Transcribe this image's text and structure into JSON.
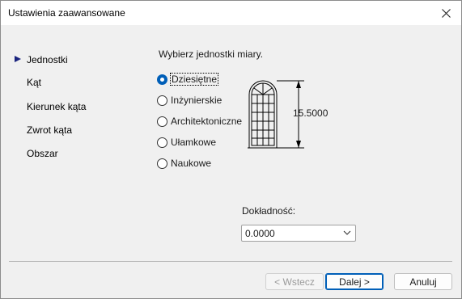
{
  "window": {
    "title": "Ustawienia zaawansowane"
  },
  "nav": {
    "items": [
      {
        "label": "Jednostki",
        "active": true
      },
      {
        "label": "Kąt",
        "active": false
      },
      {
        "label": "Kierunek kąta",
        "active": false
      },
      {
        "label": "Zwrot kąta",
        "active": false
      },
      {
        "label": "Obszar",
        "active": false
      }
    ]
  },
  "main": {
    "instruction": "Wybierz jednostki miary.",
    "options": [
      {
        "label": "Dziesiętne",
        "checked": true
      },
      {
        "label": "Inżynierskie",
        "checked": false
      },
      {
        "label": "Architektoniczne",
        "checked": false
      },
      {
        "label": "Ułamkowe",
        "checked": false
      },
      {
        "label": "Naukowe",
        "checked": false
      }
    ],
    "preview_dimension": "15.5000",
    "precision_label": "Dokładność:",
    "precision_value": "0.0000"
  },
  "footer": {
    "back_label": "< Wstecz",
    "next_label": "Dalej >",
    "cancel_label": "Anuluj"
  },
  "icons": {
    "close": "close-icon",
    "nav_marker": "triangle-right-icon",
    "dropdown": "chevron-down-icon",
    "preview": "window-drawing-icon"
  },
  "colors": {
    "accent": "#005fb8",
    "nav_marker": "#1a237e",
    "dialog_bg": "#f0f0f0"
  }
}
